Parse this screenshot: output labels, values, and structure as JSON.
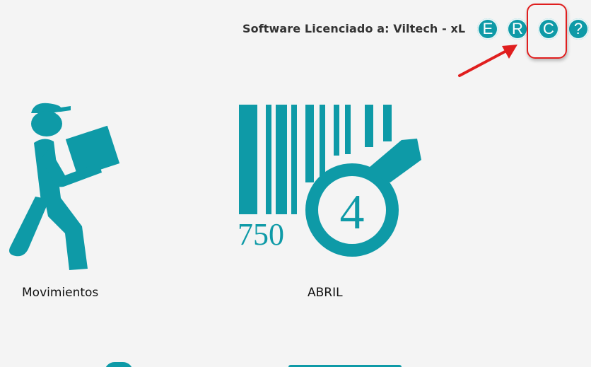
{
  "header": {
    "license_text": "Software Licenciado a: Viltech - xL",
    "buttons": [
      {
        "letter": "E"
      },
      {
        "letter": "R"
      },
      {
        "letter": "C"
      },
      {
        "letter": "?"
      }
    ]
  },
  "tiles": [
    {
      "label": "Movimientos"
    },
    {
      "label": "ABRIL",
      "barcode_number": "750",
      "tag_digit": "4"
    }
  ],
  "colors": {
    "accent": "#0e9aa7",
    "highlight": "#e01e1e",
    "background": "#f4f4f4"
  }
}
